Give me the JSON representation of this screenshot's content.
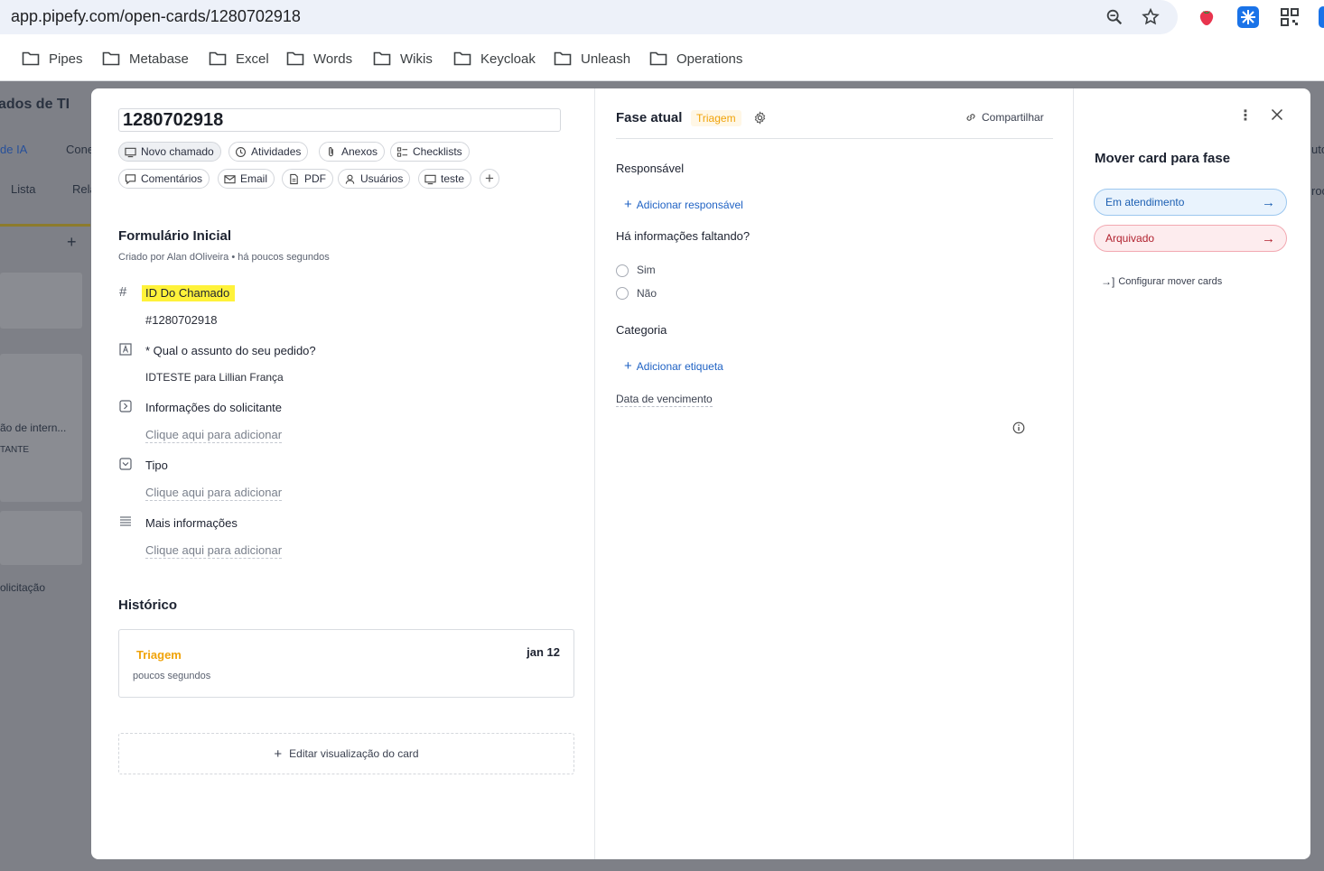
{
  "browser": {
    "url": "app.pipefy.com/open-cards/1280702918",
    "bookmarks": [
      "Pipes",
      "Metabase",
      "Excel",
      "Words",
      "Wikis",
      "Keycloak",
      "Unleash",
      "Operations"
    ]
  },
  "background": {
    "pipe_title": "ados de TI",
    "tab_ia": "de IA",
    "tab_con": "Cone",
    "tab_lista": "Lista",
    "tab_rel": "Rela",
    "card_text": "ão de intern...",
    "card_badge": "TANTE",
    "bottom_text": "olicitação",
    "right_text_1": "uto",
    "right_text_2": "roc"
  },
  "card": {
    "title": "1280702918",
    "chips": [
      {
        "label": "Novo chamado",
        "icon": "screen-icon"
      },
      {
        "label": "Atividades",
        "icon": "history-icon"
      },
      {
        "label": "Anexos",
        "icon": "paperclip-icon"
      },
      {
        "label": "Checklists",
        "icon": "checklist-icon"
      },
      {
        "label": "Comentários",
        "icon": "comment-icon"
      },
      {
        "label": "Email",
        "icon": "mail-icon"
      },
      {
        "label": "PDF",
        "icon": "document-icon"
      },
      {
        "label": "Usuários",
        "icon": "user-icon"
      },
      {
        "label": "teste",
        "icon": "screen-icon"
      }
    ],
    "form": {
      "title": "Formulário Inicial",
      "created": "Criado por Alan dOliveira • há poucos segundos",
      "fields": [
        {
          "label": "ID Do Chamado",
          "value": "#1280702918",
          "icon": "hash-icon"
        },
        {
          "label": "* Qual o assunto do seu pedido?",
          "value": "IDTESTE para Lillian França",
          "icon": "text-field-icon"
        },
        {
          "label": "Informações do solicitante",
          "value": "Clique aqui para adicionar",
          "icon": "connection-icon"
        },
        {
          "label": "Tipo",
          "value": "Clique aqui para adicionar",
          "icon": "select-icon"
        },
        {
          "label": "Mais informações",
          "value": "Clique aqui para adicionar",
          "icon": "long-text-icon"
        }
      ]
    },
    "history": {
      "title": "Histórico",
      "phase": "Triagem",
      "date": "jan 12",
      "time": "poucos segundos"
    },
    "edit_view": "Editar visualização do card"
  },
  "phase_panel": {
    "label": "Fase atual",
    "phase": "Triagem",
    "share": "Compartilhar",
    "responsible_label": "Responsável",
    "add_responsible": "Adicionar responsável",
    "missing_label": "Há informações faltando?",
    "options": [
      "Sim",
      "Não"
    ],
    "category_label": "Categoria",
    "add_tag": "Adicionar etiqueta",
    "due_label": "Data de vencimento"
  },
  "move_panel": {
    "title": "Mover card para fase",
    "targets": [
      {
        "label": "Em atendimento",
        "color": "#1c5fb2"
      },
      {
        "label": "Arquivado",
        "color": "#b1222f"
      }
    ],
    "configure": "Configurar mover cards"
  },
  "colors": {
    "phase_accent": "#f0a30a",
    "link_blue": "#1f62c4",
    "highlight": "#fff23a"
  }
}
